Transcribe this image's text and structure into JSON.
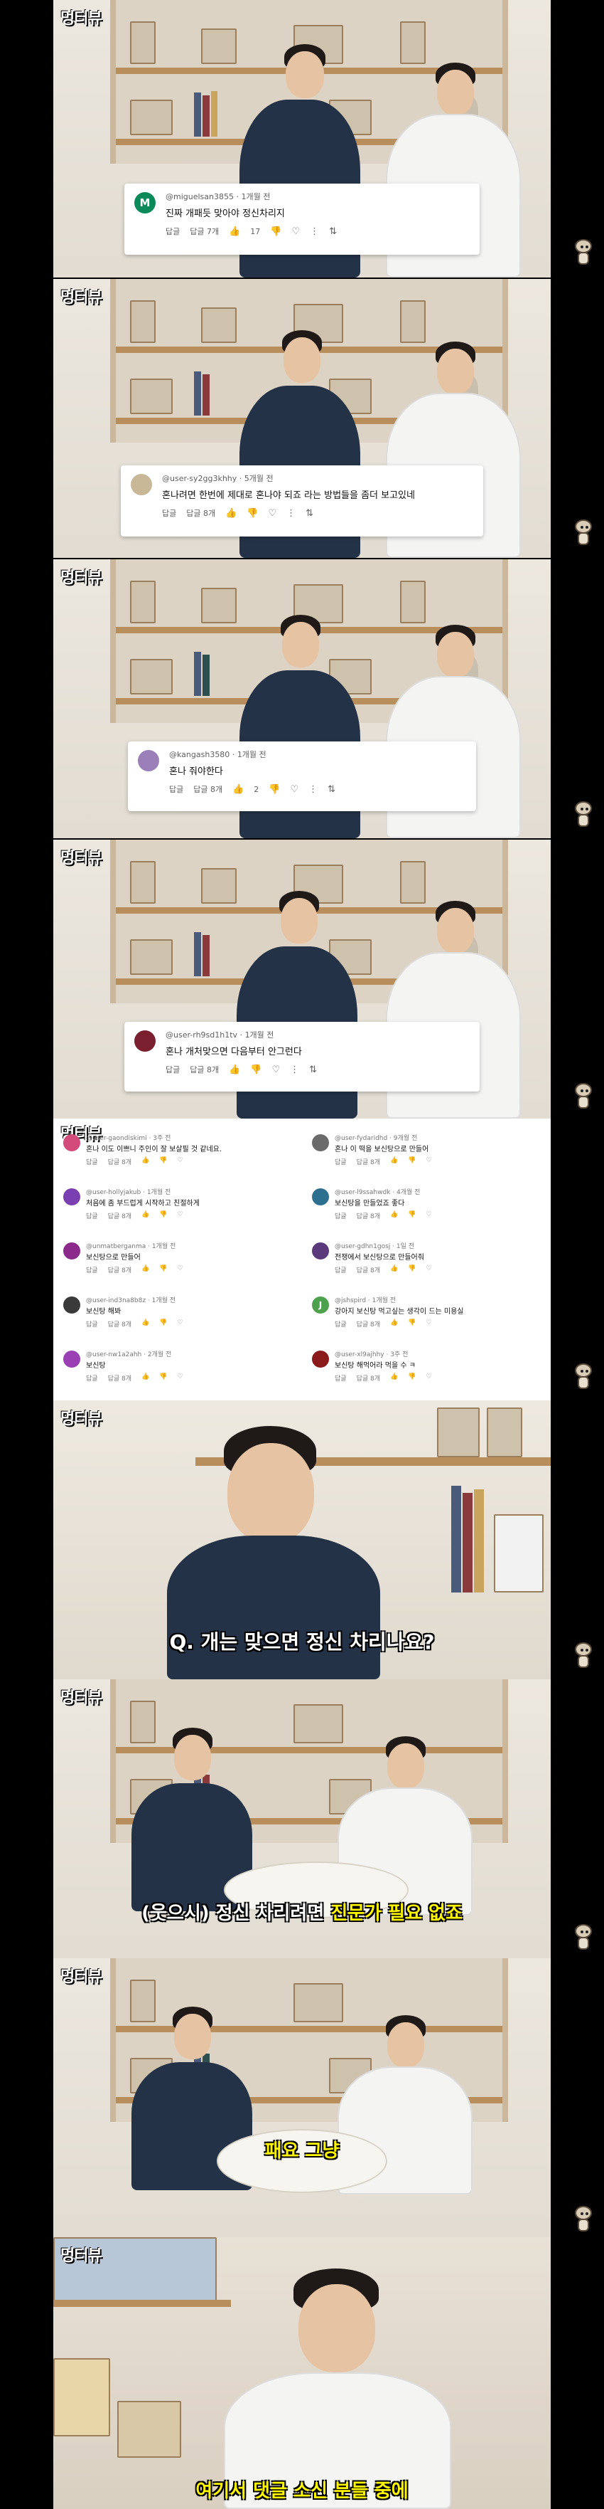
{
  "logo": "멍터뷰",
  "colors": {
    "brand_red": "#c8102e",
    "subtitle_yellow": "#fff600",
    "card_text": "#0f0f0f"
  },
  "frames": [
    {
      "comment": {
        "avatar_letter": "M",
        "avatar_color": "#0a8a5a",
        "user": "@miguelsan3855",
        "time": "1개월 전",
        "text": "진짜 개패듯 맞아야 정신차리지",
        "reply": "답글",
        "replies": "답글 7개",
        "likes": "17"
      }
    },
    {
      "comment": {
        "avatar_letter": "",
        "avatar_color": "#c9b897",
        "user": "@user-sy2gg3khhy",
        "time": "5개월 전",
        "text": "혼나려면 한번에 제대로 혼나야 되죠 라는 방법들을 좀더 보고있네",
        "reply": "답글",
        "replies": "답글 8개",
        "likes": ""
      }
    },
    {
      "comment": {
        "avatar_letter": "",
        "avatar_color": "#9a7fb8",
        "user": "@kangash3580",
        "time": "1개월 전",
        "text": "혼나 줘야한다",
        "reply": "답글",
        "replies": "답글 8개",
        "likes": "2"
      }
    },
    {
      "comment": {
        "avatar_letter": "",
        "avatar_color": "#7a1f2e",
        "user": "@user-rh9sd1h1tv",
        "time": "1개월 전",
        "text": "혼나 개처맞으면 다음부터 안그런다",
        "reply": "답글",
        "replies": "답글 8개",
        "likes": ""
      }
    }
  ],
  "collage": {
    "left": [
      {
        "av": "",
        "color": "#d24b7a",
        "user": "@user-gaondiskimi",
        "time": "3주 전",
        "text": "혼나 이도 이쁘니 주인이 잘 보살필 것 같네요.",
        "reply": "답글",
        "replies": "답글 8개"
      },
      {
        "av": "",
        "color": "#7a3fb0",
        "user": "@user-hollyjakub",
        "time": "1개월 전",
        "text": "처음에 좀 부드럽게 시작하고 친절하게",
        "reply": "답글",
        "replies": "답글 8개"
      },
      {
        "av": "",
        "color": "#8b2a8b",
        "user": "@unmatberganma",
        "time": "1개월 전",
        "text": "보신탕으로 만들어",
        "reply": "답글",
        "replies": "답글 8개"
      },
      {
        "av": "",
        "color": "#3a3a3a",
        "user": "@user-ind3na8b8z",
        "time": "1개월 전",
        "text": "보신탕 해봐",
        "reply": "답글",
        "replies": "답글 8개"
      },
      {
        "av": "",
        "color": "#9b3fb5",
        "user": "@user-nw1a2ahh",
        "time": "2개월 전",
        "text": "보신탕",
        "reply": "답글",
        "replies": "답글 8개"
      }
    ],
    "right": [
      {
        "av": "",
        "color": "#6b6b6b",
        "user": "@user-fydaridhd",
        "time": "9개월 전",
        "text": "혼나 이 떡을 보신탕으로 만들어",
        "reply": "답글",
        "replies": "답글 8개"
      },
      {
        "av": "",
        "color": "#2d6f8f",
        "user": "@user-l9ssahwdk",
        "time": "4개월 전",
        "text": "보신탕을 만들었죠 좋다",
        "reply": "답글",
        "replies": "답글 8개"
      },
      {
        "av": "",
        "color": "#5a3a7a",
        "user": "@user-gdhn1gosj",
        "time": "1일 전",
        "text": "전쟁에서 보신탕으로 만들어줘",
        "reply": "답글",
        "replies": "답글 8개"
      },
      {
        "av": "J",
        "color": "#4ea24e",
        "user": "@jshspird",
        "time": "1개월 전",
        "text": "강아지 보신탕 먹고싶는 생각이 드는 미용실",
        "reply": "답글",
        "replies": "답글 8개"
      },
      {
        "av": "",
        "color": "#8b1a1a",
        "user": "@user-xl9ajhhy",
        "time": "3주 전",
        "text": "보신탕 해먹어라 먹을 수 ㅋ",
        "reply": "답글",
        "replies": "답글 8개"
      }
    ]
  },
  "subtitles": {
    "q": "Q. 개는 맞으면 정신 차리나요?",
    "y_prefix": "(웃으시) 정신 차리려면",
    "y_emph": "진문가 필요 없죠",
    "y2": "패요 그냥",
    "y3": "여기서 댓글 소신 분들 중에"
  }
}
